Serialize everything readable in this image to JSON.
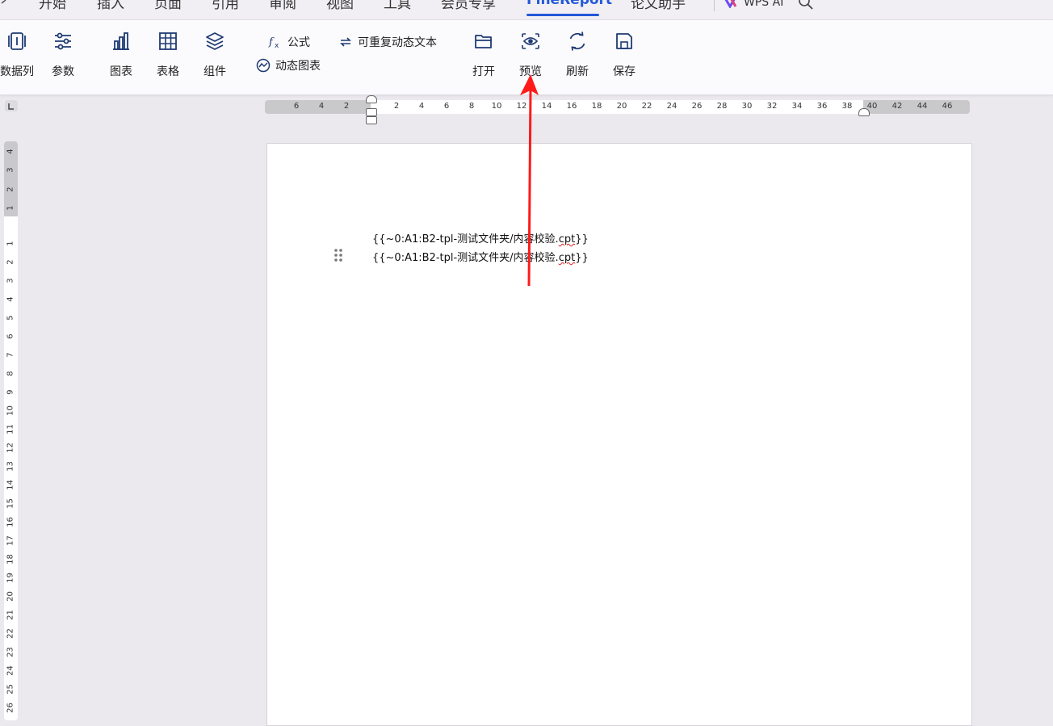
{
  "tabs": [
    {
      "label": "开始",
      "active": false
    },
    {
      "label": "插入",
      "active": false
    },
    {
      "label": "页面",
      "active": false
    },
    {
      "label": "引用",
      "active": false
    },
    {
      "label": "审阅",
      "active": false
    },
    {
      "label": "视图",
      "active": false
    },
    {
      "label": "工具",
      "active": false
    },
    {
      "label": "会员专享",
      "active": false
    },
    {
      "label": "FineReport",
      "active": true
    },
    {
      "label": "论文助手",
      "active": false
    }
  ],
  "wps_ai": {
    "label": "WPS AI",
    "icon": "wps-ai-icon"
  },
  "search": {
    "icon": "search-icon"
  },
  "ribbon": {
    "data_column": {
      "label": "数据列",
      "icon": "data-column-icon"
    },
    "params": {
      "label": "参数",
      "icon": "sliders-icon"
    },
    "chart": {
      "label": "图表",
      "icon": "bar-chart-icon"
    },
    "table": {
      "label": "表格",
      "icon": "table-icon"
    },
    "component": {
      "label": "组件",
      "icon": "layers-icon"
    },
    "formula": {
      "label": "公式",
      "icon": "fx-icon"
    },
    "dynamic_chart": {
      "label": "动态图表",
      "icon": "dynamic-chart-icon"
    },
    "repeat_text": {
      "label": "可重复动态文本",
      "icon": "repeat-icon"
    },
    "open": {
      "label": "打开",
      "icon": "folder-icon"
    },
    "preview": {
      "label": "预览",
      "icon": "eye-icon"
    },
    "refresh": {
      "label": "刷新",
      "icon": "refresh-icon"
    },
    "save": {
      "label": "保存",
      "icon": "save-icon"
    }
  },
  "ruler": {
    "horizontal": [
      "6",
      "4",
      "2",
      "2",
      "4",
      "6",
      "8",
      "10",
      "12",
      "14",
      "16",
      "18",
      "20",
      "22",
      "24",
      "26",
      "28",
      "30",
      "32",
      "34",
      "36",
      "38",
      "40",
      "42",
      "44",
      "46"
    ],
    "vertical": [
      "4",
      "3",
      "2",
      "1",
      "1",
      "2",
      "3",
      "4",
      "5",
      "6",
      "7",
      "8",
      "9",
      "10",
      "11",
      "12",
      "13",
      "14",
      "15",
      "16",
      "17",
      "18",
      "19",
      "20",
      "21",
      "22",
      "23",
      "24",
      "25",
      "26"
    ]
  },
  "document": {
    "lines": [
      {
        "prefix": "{{~0:A1:B2-tpl-测试文件夹/内容校验.",
        "underlined": "cpt",
        "suffix": "}}"
      },
      {
        "prefix": "{{~0:A1:B2-tpl-测试文件夹/内容校验.",
        "underlined": "cpt",
        "suffix": "}}"
      }
    ]
  },
  "colors": {
    "accent": "#2459d8",
    "arrow": "#ff1a1a",
    "icon": "#1f3b73"
  }
}
